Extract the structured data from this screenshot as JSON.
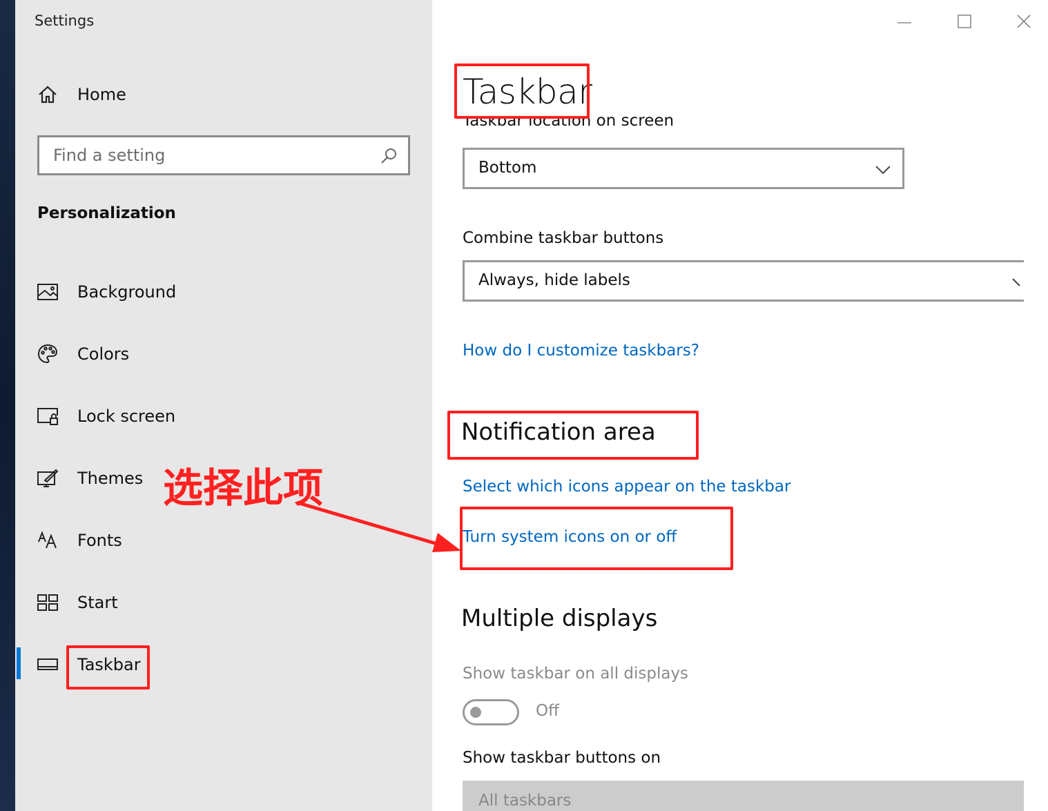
{
  "window": {
    "title": "Settings",
    "controls": {
      "minimize": "minimize-icon",
      "maximize": "maximize-icon",
      "close": "close-icon"
    }
  },
  "sidebar": {
    "home": {
      "label": "Home",
      "icon": "home-icon"
    },
    "search": {
      "placeholder": "Find a setting",
      "icon": "search-icon"
    },
    "section_header": "Personalization",
    "items": [
      {
        "label": "Background",
        "icon": "image-icon",
        "selected": false
      },
      {
        "label": "Colors",
        "icon": "palette-icon",
        "selected": false
      },
      {
        "label": "Lock screen",
        "icon": "lock-screen-icon",
        "selected": false
      },
      {
        "label": "Themes",
        "icon": "themes-icon",
        "selected": false
      },
      {
        "label": "Fonts",
        "icon": "fonts-icon",
        "selected": false
      },
      {
        "label": "Start",
        "icon": "start-icon",
        "selected": false
      },
      {
        "label": "Taskbar",
        "icon": "taskbar-icon",
        "selected": true
      }
    ],
    "accent_color": "#0078d7"
  },
  "main": {
    "title": "Taskbar",
    "location": {
      "label": "Taskbar location on screen",
      "value": "Bottom"
    },
    "combine": {
      "label": "Combine taskbar buttons",
      "value": "Always, hide labels"
    },
    "help_link": "How do I customize taskbars?",
    "notification_area": {
      "header": "Notification area",
      "link_icons": "Select which icons appear on the taskbar",
      "link_system_icons": "Turn system icons on or off"
    },
    "multiple_displays": {
      "header": "Multiple displays",
      "show_all_label": "Show taskbar on all displays",
      "toggle_state": "Off",
      "buttons_on_label": "Show taskbar buttons on",
      "buttons_on_value": "All taskbars"
    },
    "link_color": "#0067c0"
  },
  "annotation": {
    "text": "选择此项",
    "color": "#ff2020"
  }
}
